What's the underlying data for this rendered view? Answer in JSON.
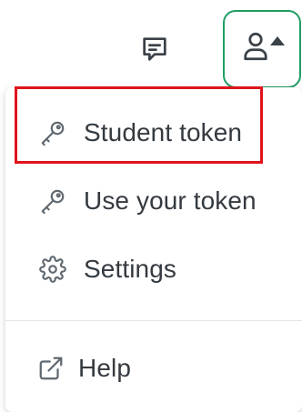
{
  "header": {
    "chat_icon": "message-square-text-icon",
    "user_icon": "user-icon",
    "caret_icon": "caret-up-icon",
    "user_button_border_color": "#1f9d63"
  },
  "menu": {
    "items": [
      {
        "label": "Student token",
        "icon": "key-icon"
      },
      {
        "label": "Use your token",
        "icon": "key-icon"
      },
      {
        "label": "Settings",
        "icon": "gear-icon"
      }
    ],
    "footer": {
      "label": "Help",
      "icon": "external-link-icon"
    }
  },
  "highlight": {
    "color": "#e0131c",
    "target": "Student token"
  }
}
